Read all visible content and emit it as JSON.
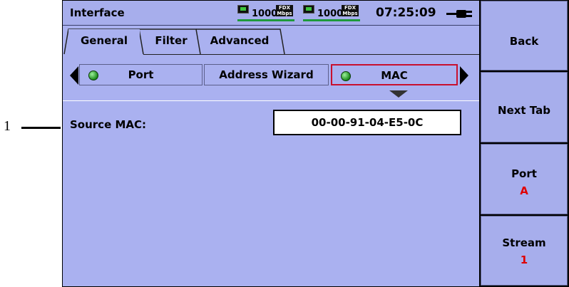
{
  "callout": {
    "number": "1"
  },
  "header": {
    "title": "Interface",
    "link_a": {
      "speed": "1000",
      "duplex_top": "FDX",
      "duplex_bottom": "Mbps"
    },
    "link_b": {
      "speed": "1000",
      "duplex_top": "FDX",
      "duplex_bottom": "Mbps"
    },
    "clock": "07:25:09"
  },
  "tabs": [
    {
      "label": "General",
      "active": true
    },
    {
      "label": "Filter",
      "active": false
    },
    {
      "label": "Advanced",
      "active": false
    }
  ],
  "selector": {
    "items": [
      {
        "label": "Port",
        "indicator": "green-dot",
        "selected": false
      },
      {
        "label": "Address Wizard",
        "indicator": "",
        "selected": false
      },
      {
        "label": "MAC",
        "indicator": "green-dot",
        "selected": true
      }
    ]
  },
  "mac_panel": {
    "label": "Source MAC:",
    "value": "00-00-91-04-E5-0C"
  },
  "side_buttons": {
    "back": "Back",
    "next_tab": "Next Tab",
    "port": {
      "label": "Port",
      "value": "A"
    },
    "stream": {
      "label": "Stream",
      "value": "1"
    }
  },
  "colors": {
    "background": "#aab1f0",
    "link_ok": "#1e9a3a",
    "selected_border": "#c8102e",
    "side_value": "#e00000"
  }
}
